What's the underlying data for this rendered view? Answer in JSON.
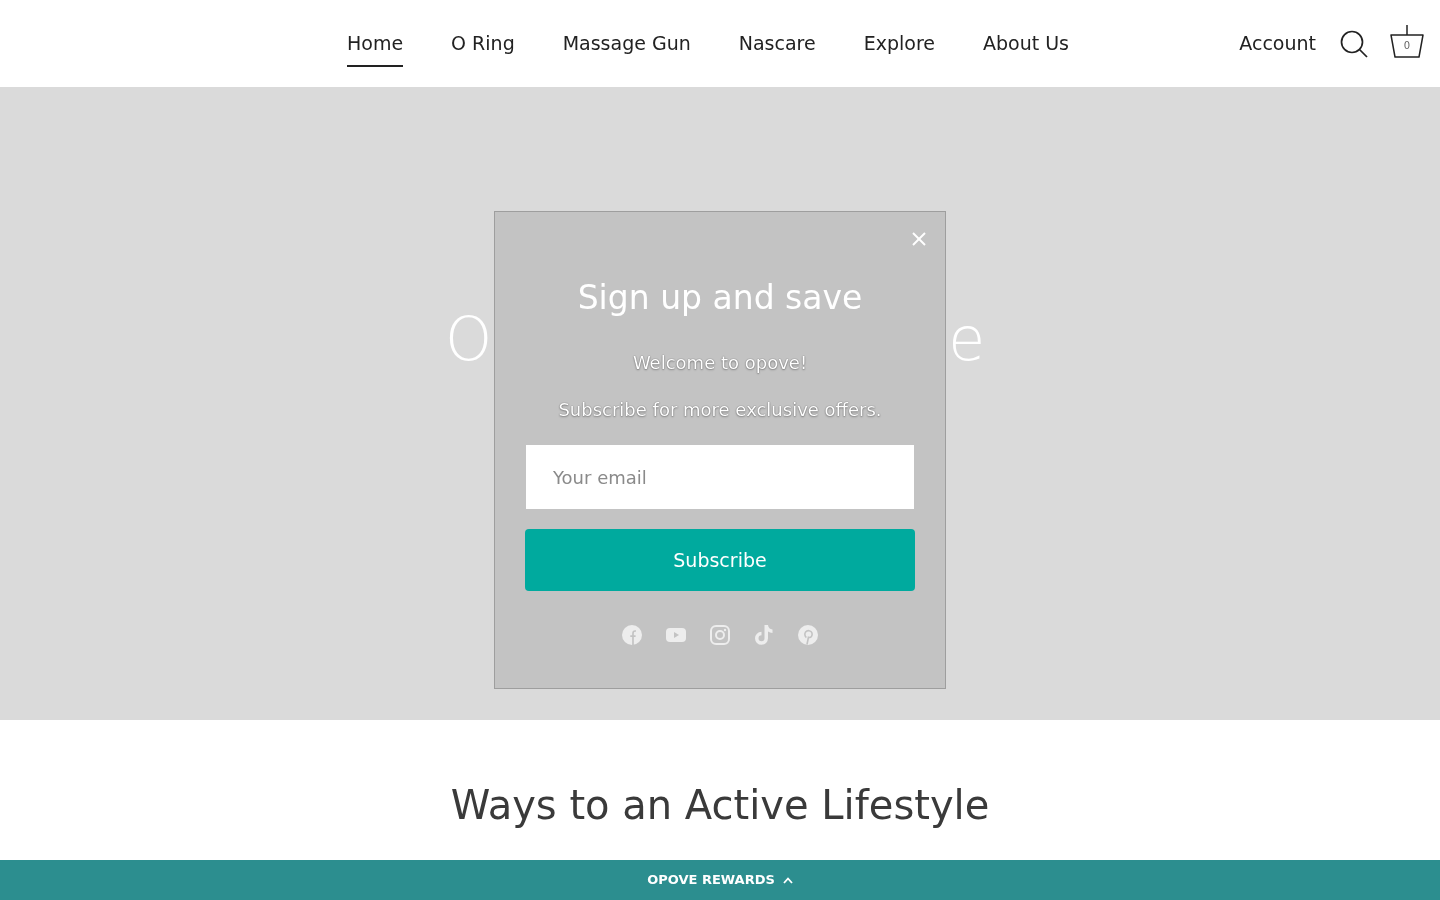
{
  "header": {
    "nav": [
      {
        "label": "Home",
        "selected": true
      },
      {
        "label": "O Ring",
        "selected": false
      },
      {
        "label": "Massage Gun",
        "selected": false
      },
      {
        "label": "Nascare",
        "selected": false
      },
      {
        "label": "Explore",
        "selected": false
      },
      {
        "label": "About Us",
        "selected": false
      }
    ],
    "account": "Account",
    "cart_count": "0"
  },
  "hero": {
    "title_visible_parts": [
      "O",
      "e"
    ]
  },
  "popup": {
    "title": "Sign up and save",
    "lines": [
      "Welcome to opove!",
      "Subscribe for more exclusive offers."
    ],
    "email": {
      "placeholder": "Your email"
    },
    "button": "Subscribe"
  },
  "section": {
    "heading": "Ways to an Active Lifestyle"
  },
  "rewards_bar": {
    "label": "OPOVE REWARDS"
  }
}
